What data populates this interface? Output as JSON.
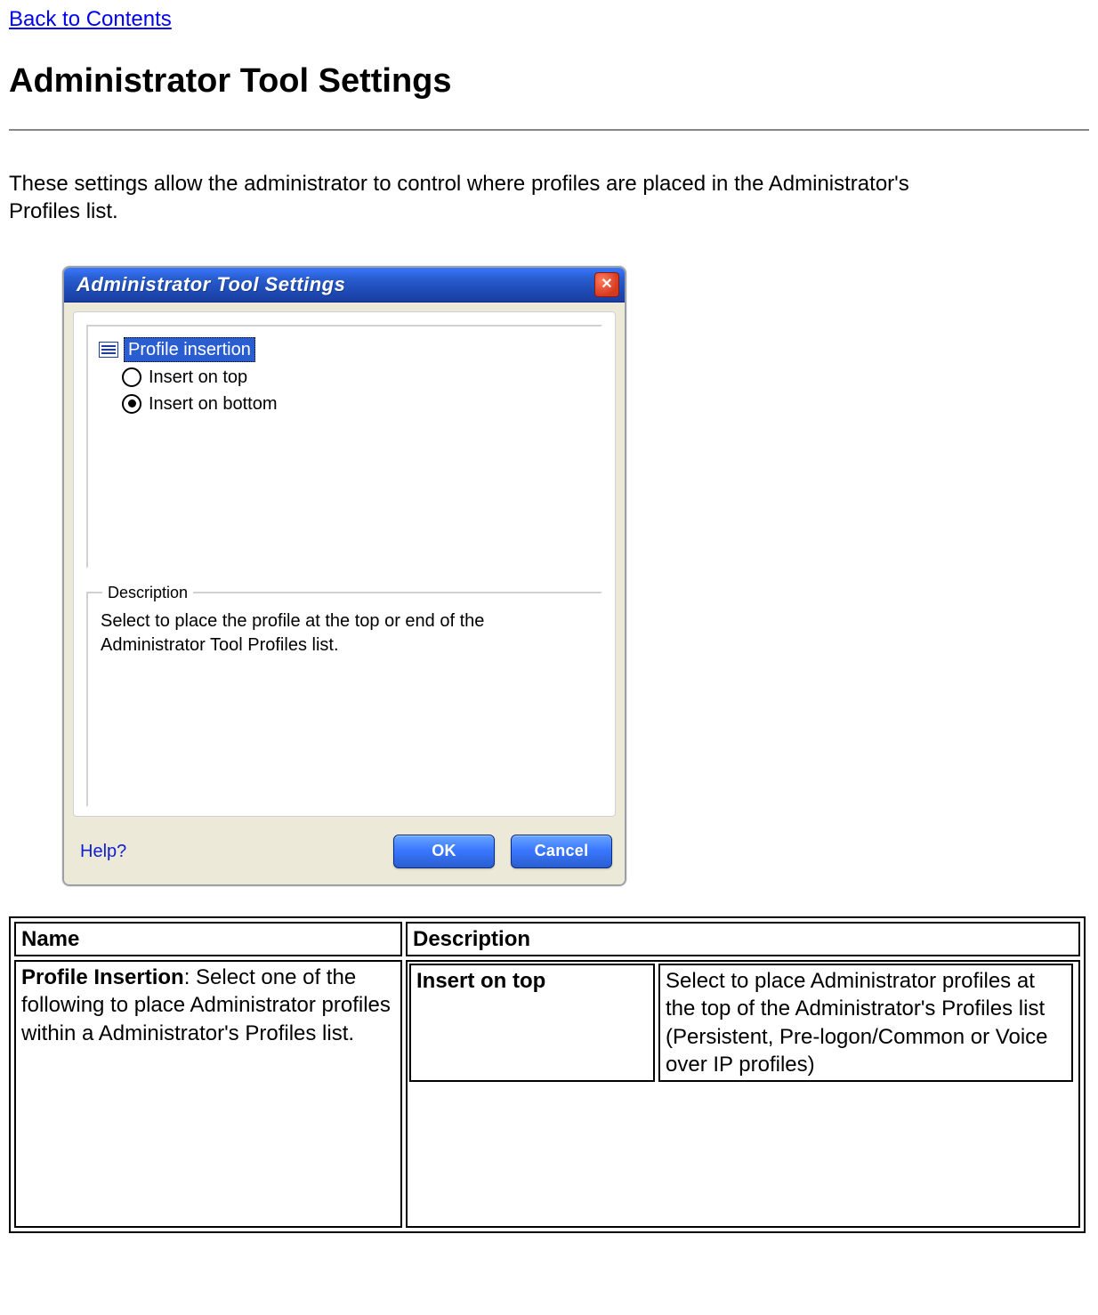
{
  "nav": {
    "back_link": "Back to Contents"
  },
  "page": {
    "title": "Administrator Tool Settings",
    "intro": "These settings allow the administrator to control where profiles are placed in the Administrator's Profiles list."
  },
  "dialog": {
    "title": "Administrator Tool Settings",
    "close_label": "✕",
    "tree": {
      "root_label": "Profile insertion",
      "options": [
        {
          "label": "Insert on top",
          "selected": false
        },
        {
          "label": "Insert on bottom",
          "selected": true
        }
      ]
    },
    "description": {
      "legend": "Description",
      "text": "Select to place the profile at the top or end of the Administrator Tool Profiles list."
    },
    "buttons": {
      "help": "Help?",
      "ok": "OK",
      "cancel": "Cancel"
    }
  },
  "table": {
    "headers": {
      "name": "Name",
      "description": "Description"
    },
    "rows": [
      {
        "name_bold": "Profile Insertion",
        "name_rest": ": Select one of the following to place Administrator profiles within a Administrator's Profiles list.",
        "inner": [
          {
            "left": "Insert on top",
            "right": "Select to place Administrator profiles at the top of the Administrator's Profiles list (Persistent, Pre-logon/Common or Voice over IP profiles)"
          }
        ]
      }
    ]
  }
}
